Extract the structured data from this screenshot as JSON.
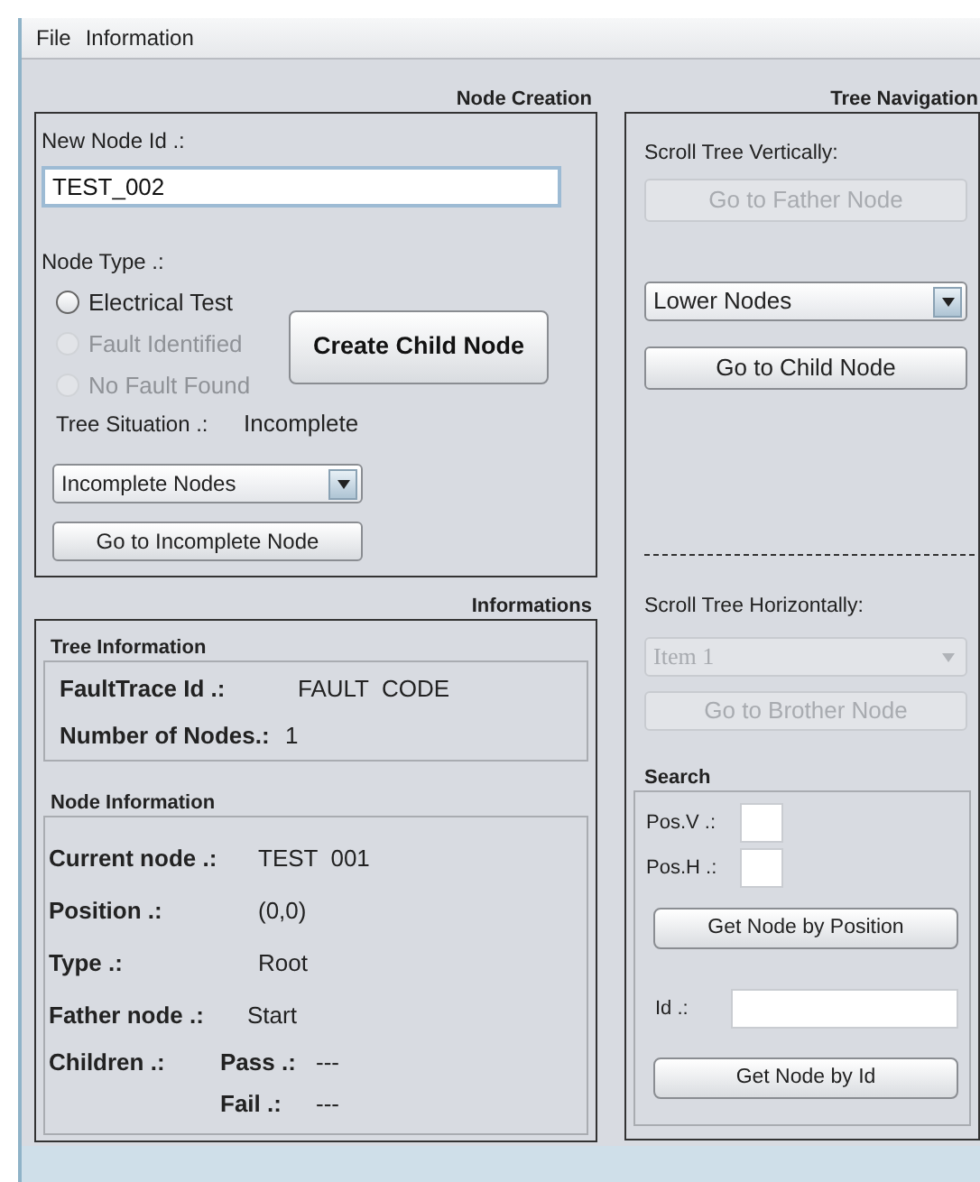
{
  "menu": [
    {
      "label": "File"
    },
    {
      "label": "Information"
    }
  ],
  "node_creation": {
    "title": "Node Creation",
    "new_node_id_label": "New Node Id .:",
    "new_node_id": "TEST_002",
    "node_type_label": "Node Type .:",
    "node_types": [
      {
        "label": "Electrical Test",
        "selected": false,
        "disabled": false
      },
      {
        "label": "Fault Identified",
        "selected": false,
        "disabled": true
      },
      {
        "label": "No Fault Found",
        "selected": false,
        "disabled": true
      }
    ],
    "create_button": "Create Child Node",
    "tree_situation_label": "Tree Situation .:",
    "tree_situation": "Incomplete",
    "dropdown": {
      "value": "Incomplete Nodes",
      "disabled": false
    },
    "go_button": {
      "label": "Go to Incomplete Node",
      "disabled": false
    }
  },
  "informations": {
    "title": "Informations",
    "tree_information": {
      "title": "Tree Information",
      "rows": [
        {
          "label": "FaultTrace Id .:",
          "value": "FAULT  CODE"
        },
        {
          "label": "Number of Nodes.:",
          "value": "1"
        }
      ]
    },
    "node_information": {
      "title": "Node Information",
      "rows": [
        {
          "label": "Current node .:",
          "value": "TEST  001"
        },
        {
          "label": "Position .:",
          "value": "(0,0)"
        },
        {
          "label": "Type .:",
          "value": "Root"
        },
        {
          "label": "Father node .:",
          "value": "Start"
        }
      ],
      "children": {
        "label": "Children .:",
        "pass_label": "Pass .:",
        "pass": "---",
        "fail_label": "Fail .:",
        "fail": "---"
      }
    }
  },
  "tree_navigation": {
    "title": "Tree Navigation",
    "vertical_label": "Scroll Tree Vertically:",
    "father_button": {
      "label": "Go to Father Node",
      "disabled": true
    },
    "vertical_dropdown": {
      "value": "Lower Nodes",
      "disabled": false
    },
    "child_button": {
      "label": "Go to Child Node",
      "disabled": false
    },
    "horizontal_label": "Scroll Tree Horizontally:",
    "horizontal_dropdown": {
      "value": "Item 1",
      "disabled": true
    },
    "brother_button": {
      "label": "Go to Brother Node",
      "disabled": true
    },
    "search": {
      "title": "Search",
      "pos_v_label": "Pos.V .:",
      "pos_h_label": "Pos.H .:",
      "position_button": "Get Node by Position",
      "id_label": "Id .:",
      "id_button": "Get Node by Id"
    }
  }
}
